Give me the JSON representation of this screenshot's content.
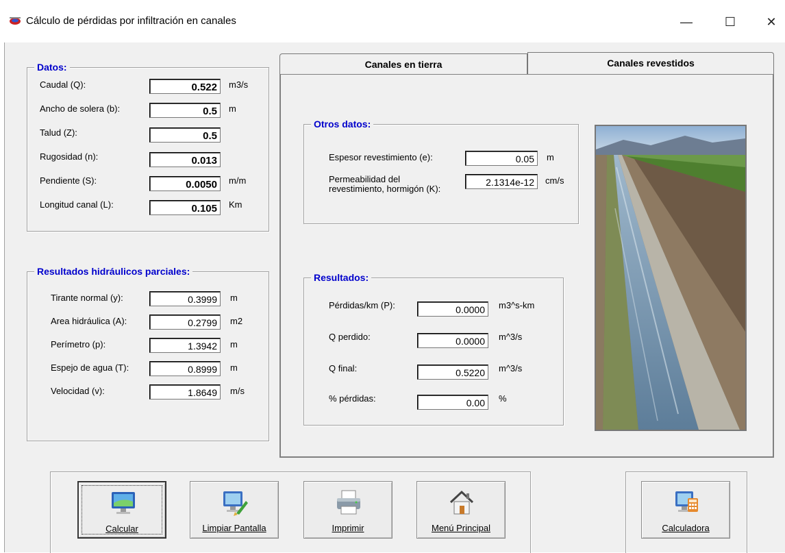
{
  "window": {
    "title": "Cálculo de pérdidas por infiltración en canales",
    "minimize": "—",
    "maximize": "☐",
    "close": "✕"
  },
  "datos": {
    "title": "Datos:",
    "rows": [
      {
        "label": "Caudal (Q):",
        "value": "0.522",
        "unit": "m3/s"
      },
      {
        "label": "Ancho de solera (b):",
        "value": "0.5",
        "unit": "m"
      },
      {
        "label": "Talud (Z):",
        "value": "0.5",
        "unit": ""
      },
      {
        "label": "Rugosidad (n):",
        "value": "0.013",
        "unit": ""
      },
      {
        "label": "Pendiente (S):",
        "value": "0.0050",
        "unit": "m/m"
      },
      {
        "label": "Longitud  canal (L):",
        "value": "0.105",
        "unit": "Km"
      }
    ]
  },
  "hidraulicos": {
    "title": "Resultados hidráulicos parciales:",
    "rows": [
      {
        "label": "Tirante normal (y):",
        "value": "0.3999",
        "unit": "m"
      },
      {
        "label": "Area hidráulica (A):",
        "value": "0.2799",
        "unit": "m2"
      },
      {
        "label": "Perímetro (p):",
        "value": "1.3942",
        "unit": "m"
      },
      {
        "label": "Espejo de agua (T):",
        "value": "0.8999",
        "unit": "m"
      },
      {
        "label": "Velocidad (v):",
        "value": "1.8649",
        "unit": "m/s"
      }
    ]
  },
  "tabs": [
    {
      "label": "Canales en tierra",
      "active": false
    },
    {
      "label": "Canales revestidos",
      "active": true
    }
  ],
  "otros": {
    "title": "Otros datos:",
    "espesor_label": "Espesor revestimiento (e):",
    "espesor_value": "0.05",
    "espesor_unit": "m",
    "perm_label_1": "Permeabilidad del",
    "perm_label_2": "revestimiento, hormigón (K):",
    "perm_value": "2.1314e-12",
    "perm_unit": "cm/s"
  },
  "resultados": {
    "title": "Resultados:",
    "rows": [
      {
        "label": "Pérdidas/km (P):",
        "value": "0.0000",
        "unit": "m3^s-km"
      },
      {
        "label": "Q perdido:",
        "value": "0.0000",
        "unit": "m^3/s"
      },
      {
        "label": "Q final:",
        "value": "0.5220",
        "unit": "m^3/s"
      },
      {
        "label": "% pérdidas:",
        "value": "0.00",
        "unit": "%"
      }
    ]
  },
  "buttons": {
    "calcular": "Calcular",
    "limpiar": "Limpiar Pantalla",
    "imprimir": "Imprimir",
    "menu": "Menú Principal",
    "calculadora": "Calculadora"
  },
  "colors": {
    "group_title": "#0000cc",
    "panel_bg": "#f0f0f0"
  },
  "icons": {
    "app": "canal-app-icon",
    "calcular": "computer-monitor-icon",
    "limpiar": "monitor-brush-icon",
    "imprimir": "printer-icon",
    "menu": "house-icon",
    "calculadora": "calculator-monitor-icon"
  }
}
